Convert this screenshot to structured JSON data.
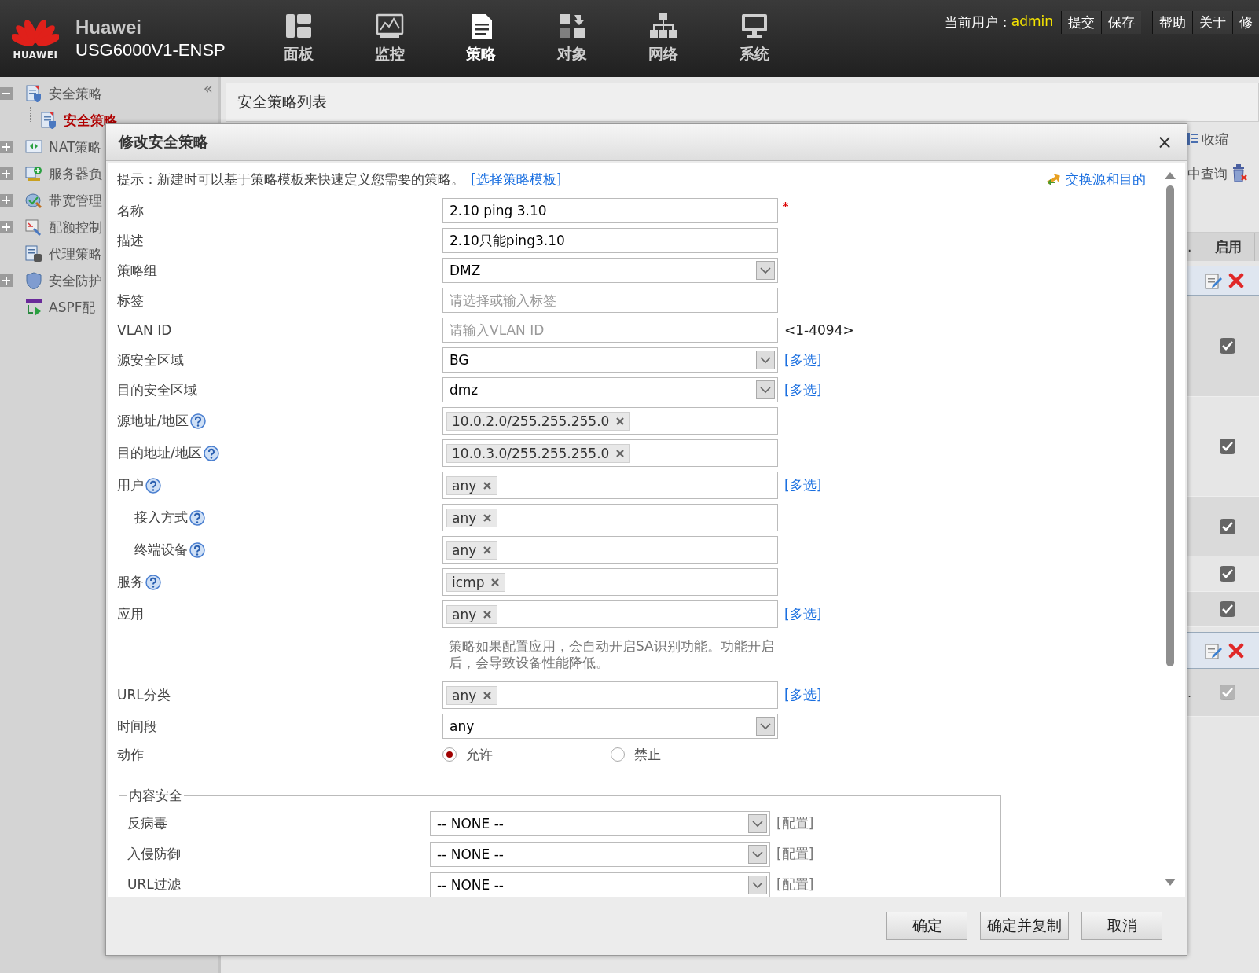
{
  "header": {
    "logo_text": "HUAWEI",
    "brand": "Huawei",
    "model": "USG6000V1-ENSP",
    "nav": [
      {
        "label": "面板",
        "selected": false
      },
      {
        "label": "监控",
        "selected": false
      },
      {
        "label": "策略",
        "selected": true
      },
      {
        "label": "对象",
        "selected": false
      },
      {
        "label": "网络",
        "selected": false
      },
      {
        "label": "系统",
        "selected": false
      }
    ],
    "user_label": "当前用户：",
    "user": "admin",
    "links": [
      "提交",
      "保存",
      "帮助",
      "关于",
      "修"
    ]
  },
  "sidebar": {
    "collapse": "«",
    "items": [
      {
        "label": "安全策略",
        "expandable": true,
        "expanded": true,
        "selected": false,
        "children": [
          {
            "label": "安全策略",
            "selected": true
          }
        ]
      },
      {
        "label": "NAT策略",
        "expandable": true,
        "expanded": false,
        "selected": false
      },
      {
        "label": "服务器负",
        "expandable": true,
        "expanded": false,
        "selected": false
      },
      {
        "label": "带宽管理",
        "expandable": true,
        "expanded": false,
        "selected": false
      },
      {
        "label": "配额控制",
        "expandable": true,
        "expanded": false,
        "selected": false
      },
      {
        "label": "代理策略",
        "expandable": false,
        "selected": false
      },
      {
        "label": "安全防护",
        "expandable": true,
        "expanded": false,
        "selected": false
      },
      {
        "label": "ASPF配",
        "expandable": false,
        "selected": false
      }
    ]
  },
  "main": {
    "title": "安全策略列表",
    "toolbar": [
      {
        "label": "收缩"
      },
      {
        "label": "中查询"
      }
    ],
    "table": {
      "columns": [
        ".",
        "启用"
      ],
      "rows": [
        {
          "kind": "actions"
        },
        {
          "kind": "check",
          "checked": true,
          "disabled": false
        },
        {
          "kind": "check",
          "checked": true,
          "disabled": false
        },
        {
          "kind": "check",
          "checked": true,
          "disabled": false
        },
        {
          "kind": "check",
          "checked": true,
          "disabled": false
        },
        {
          "kind": "check",
          "checked": true,
          "disabled": false
        },
        {
          "kind": "actions"
        },
        {
          "kind": "check",
          "checked": true,
          "disabled": true,
          "column_1": "."
        }
      ]
    }
  },
  "dialog": {
    "title": "修改安全策略",
    "close": "×",
    "hint": "提示：新建时可以基于策略模板来快速定义您需要的策略。",
    "hint_link": "[选择策略模板]",
    "swap_link": "交换源和目的",
    "fields": [
      {
        "kind": "text",
        "label": "名称",
        "value": "2.10 ping 3.10",
        "required": true
      },
      {
        "kind": "text",
        "label": "描述",
        "value": "2.10只能ping3.10"
      },
      {
        "kind": "select",
        "label": "策略组",
        "value": "DMZ"
      },
      {
        "kind": "text",
        "label": "标签",
        "placeholder": "请选择或输入标签"
      },
      {
        "kind": "text",
        "label": "VLAN ID",
        "placeholder": "请输入VLAN ID",
        "suffix": "<1-4094>"
      },
      {
        "kind": "select",
        "label": "源安全区域",
        "value": "BG",
        "link": "[多选]"
      },
      {
        "kind": "select",
        "label": "目的安全区域",
        "value": "dmz",
        "link": "[多选]"
      },
      {
        "kind": "tags",
        "label": "源地址/地区",
        "help": true,
        "tags": [
          "10.0.2.0/255.255.255.0"
        ]
      },
      {
        "kind": "tags",
        "label": "目的地址/地区",
        "help": true,
        "tags": [
          "10.0.3.0/255.255.255.0"
        ]
      },
      {
        "kind": "tags",
        "label": "用户",
        "help": true,
        "tags": [
          "any"
        ],
        "link": "[多选]",
        "children": [
          {
            "kind": "tags",
            "label": "接入方式",
            "help": true,
            "tags": [
              "any"
            ]
          },
          {
            "kind": "tags",
            "label": "终端设备",
            "help": true,
            "tags": [
              "any"
            ]
          }
        ]
      },
      {
        "kind": "tags",
        "label": "服务",
        "help": true,
        "tags": [
          "icmp"
        ]
      },
      {
        "kind": "tags",
        "label": "应用",
        "tags": [
          "any"
        ],
        "link": "[多选]",
        "note": "策略如果配置应用，会自动开启SA识别功能。功能开启后，会导致设备性能降低。"
      },
      {
        "kind": "tags",
        "label": "URL分类",
        "tags": [
          "any"
        ],
        "link": "[多选]"
      },
      {
        "kind": "select",
        "label": "时间段",
        "value": "any"
      },
      {
        "kind": "radio",
        "label": "动作",
        "options": [
          {
            "label": "允许",
            "selected": true
          },
          {
            "label": "禁止",
            "selected": false
          }
        ]
      }
    ],
    "content_security": {
      "legend": "内容安全",
      "rows": [
        {
          "label": "反病毒",
          "value": "-- NONE --",
          "link": "[配置]"
        },
        {
          "label": "入侵防御",
          "value": "-- NONE --",
          "link": "[配置]"
        },
        {
          "label": "URL过滤",
          "value": "-- NONE --",
          "link": "[配置]"
        }
      ]
    },
    "buttons": [
      "确定",
      "确定并复制",
      "取消"
    ]
  }
}
